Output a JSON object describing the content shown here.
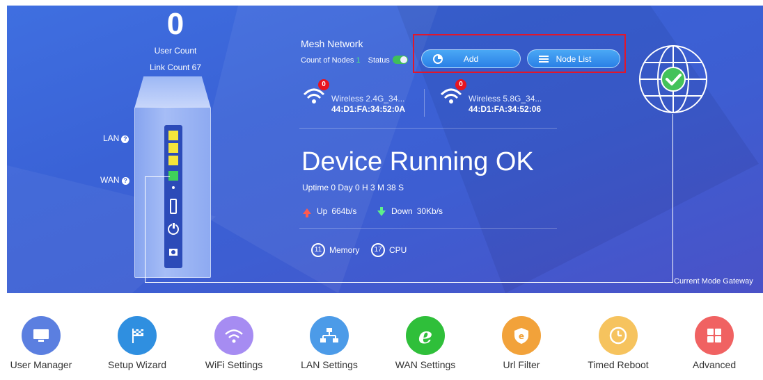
{
  "device": {
    "user_count_value": "0",
    "user_count_label": "User Count",
    "link_count_label": "Link Count 67",
    "lan_label": "LAN",
    "wan_label": "WAN",
    "help_glyph": "?"
  },
  "mesh": {
    "title": "Mesh Network",
    "count_label": "Count of Nodes",
    "count_value": "1",
    "status_label": "Status",
    "add_label": "Add",
    "node_list_label": "Node List",
    "nodes": [
      {
        "badge": "0",
        "name": "Wireless 2.4G_34...",
        "mac": "44:D1:FA:34:52:0A"
      },
      {
        "badge": "0",
        "name": "Wireless 5.8G_34...",
        "mac": "44:D1:FA:34:52:06"
      }
    ]
  },
  "status": {
    "title": "Device Running OK",
    "uptime": "Uptime 0 Day 0 H 3 M 38 S",
    "up_label": "Up",
    "up_value": "664b/s",
    "down_label": "Down",
    "down_value": "30Kb/s",
    "memory_value": "11",
    "memory_label": "Memory",
    "cpu_value": "17",
    "cpu_label": "CPU"
  },
  "mode": {
    "label": "Current Mode Gateway"
  },
  "menu": [
    {
      "label": "User Manager",
      "icon": "monitor-icon",
      "color": "#5b7fe0"
    },
    {
      "label": "Setup Wizard",
      "icon": "flag-icon",
      "color": "#2f8fe0"
    },
    {
      "label": "WiFi Settings",
      "icon": "wifi-icon",
      "color": "#a68cf2"
    },
    {
      "label": "LAN Settings",
      "icon": "network-icon",
      "color": "#4c9be8"
    },
    {
      "label": "WAN Settings",
      "icon": "ie-icon",
      "color": "#2fbf3a"
    },
    {
      "label": "Url Filter",
      "icon": "shield-icon",
      "color": "#f2a23a"
    },
    {
      "label": "Timed Reboot",
      "icon": "clock-icon",
      "color": "#f6c35e"
    },
    {
      "label": "Advanced",
      "icon": "grid-icon",
      "color": "#f06262"
    }
  ],
  "colors": {
    "banner": "#3d66d8",
    "highlight": "#e0172c",
    "badge": "#e8141f",
    "wan_port": "#3fd05a",
    "lan_port": "#f4e53a"
  }
}
